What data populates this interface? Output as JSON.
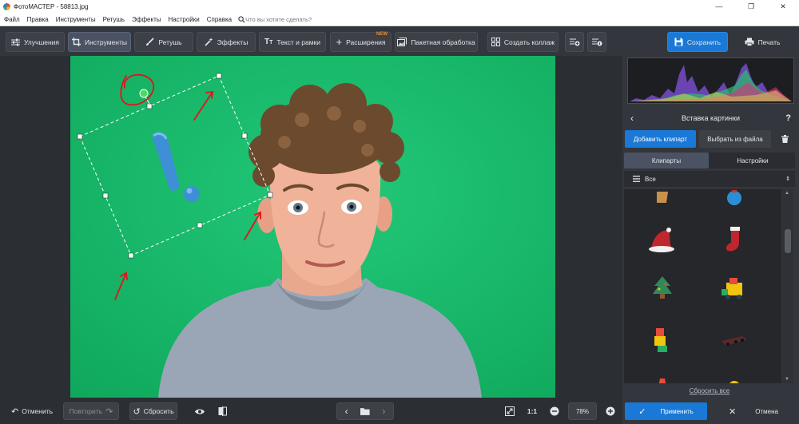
{
  "window": {
    "title": "ФотоМАСТЕР - 58813.jpg",
    "minimize_icon": "—",
    "maximize_icon": "❐",
    "close_icon": "✕"
  },
  "menu": {
    "items": [
      "Файл",
      "Правка",
      "Инструменты",
      "Ретушь",
      "Эффекты",
      "Настройки",
      "Справка"
    ],
    "search_placeholder": "Что вы хотите сделать?"
  },
  "toolbar": {
    "tabs": [
      {
        "label": "Улучшения",
        "icon": "sliders-icon"
      },
      {
        "label": "Инструменты",
        "icon": "crop-icon",
        "active": true
      },
      {
        "label": "Ретушь",
        "icon": "brush-icon"
      },
      {
        "label": "Эффекты",
        "icon": "magic-wand-icon"
      },
      {
        "label": "Текст и рамки",
        "icon": "text-icon"
      },
      {
        "label": "Расширения",
        "icon": "plus-icon",
        "badge": "NEW"
      },
      {
        "label": "Пакетная обработка",
        "icon": "image-stack-icon"
      },
      {
        "label": "Создать коллаж",
        "icon": "collage-icon"
      }
    ],
    "save_label": "Сохранить",
    "print_label": "Печать"
  },
  "panel": {
    "header": "Вставка картинки",
    "help": "?",
    "add_clipart": "Добавить клипарт",
    "from_file": "Выбрать из файла",
    "tab_cliparts": "Клипарты",
    "tab_settings": "Настройки",
    "category": "Все",
    "reset_all": "Сбросить все",
    "apply": "Применить",
    "cancel": "Отмена"
  },
  "bottom": {
    "undo": "Отменить",
    "redo": "Повторить",
    "reset": "Сбросить",
    "ratio": "1:1",
    "zoom": "78%"
  },
  "colors": {
    "accent": "#1a78d6",
    "canvas_green": "#19b96a",
    "badge_new": "#f08a2a"
  }
}
